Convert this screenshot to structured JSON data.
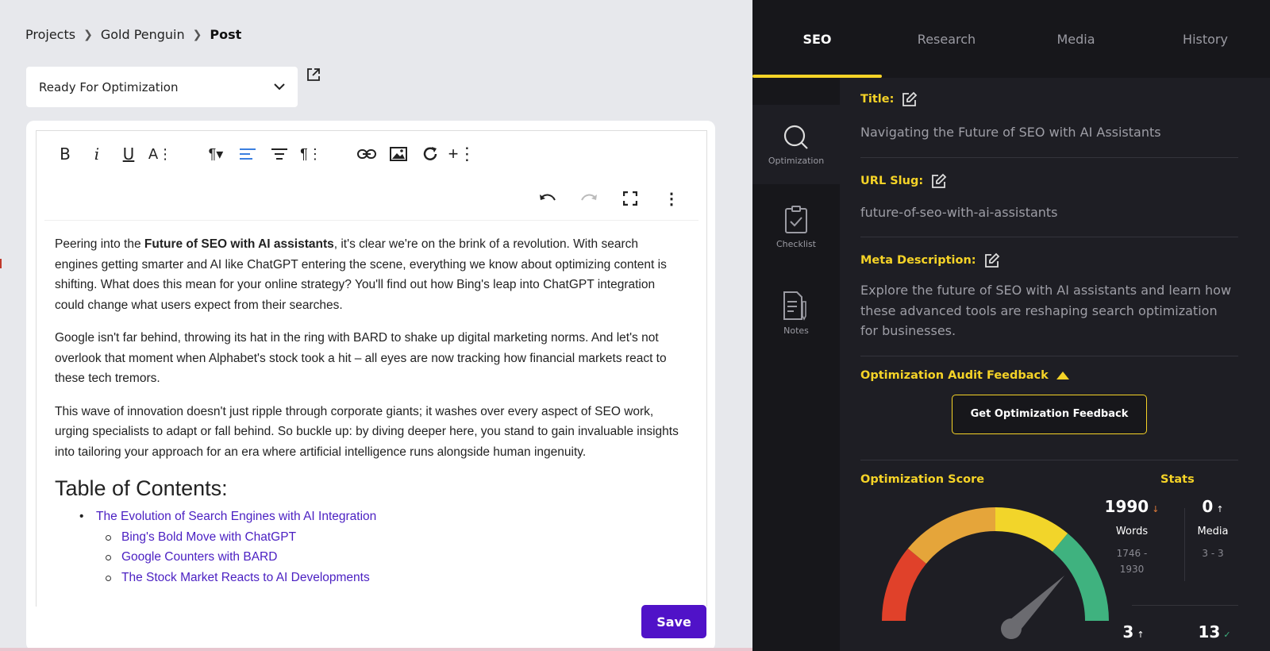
{
  "breadcrumb": {
    "items": [
      "Projects",
      "Gold Penguin"
    ],
    "current": "Post"
  },
  "status": {
    "selected": "Ready For Optimization"
  },
  "editor": {
    "paragraphs": {
      "p1_before": "Peering into the ",
      "p1_bold": "Future of SEO with AI assistants",
      "p1_after": ", it's clear we're on the brink of a revolution. With search engines getting smarter and AI like ChatGPT entering the scene, everything we know about optimizing content is shifting. What does this mean for your online strategy? You'll find out how Bing's leap into ChatGPT integration could change what users expect from their searches.",
      "p2": "Google isn't far behind, throwing its hat in the ring with BARD to shake up digital marketing norms. And let's not overlook that moment when Alphabet's stock took a hit – all eyes are now tracking how financial markets react to these tech tremors.",
      "p3": "This wave of innovation doesn't just ripple through corporate giants; it washes over every aspect of SEO work, urging specialists to adapt or fall behind. So buckle up: by diving deeper here, you stand to gain invaluable insights into tailoring your approach for an era where artificial intelligence runs alongside human ingenuity."
    },
    "toc_heading": "Table of Contents:",
    "toc": {
      "main": "The Evolution of Search Engines with AI Integration",
      "sub": [
        "Bing's Bold Move with ChatGPT",
        "Google Counters with BARD",
        "The Stock Market Reacts to AI Developments"
      ]
    },
    "save_label": "Save"
  },
  "tabs": [
    "SEO",
    "Research",
    "Media",
    "History"
  ],
  "side_nav": [
    "Optimization",
    "Checklist",
    "Notes"
  ],
  "seo": {
    "title_label": "Title:",
    "title_value": "Navigating the Future of SEO with AI Assistants",
    "slug_label": "URL Slug:",
    "slug_value": "future-of-seo-with-ai-assistants",
    "meta_label": "Meta Description:",
    "meta_value": "Explore the future of SEO with AI assistants and learn how these advanced tools are reshaping search optimization for businesses.",
    "audit_label": "Optimization Audit Feedback",
    "feedback_button": "Get Optimization Feedback",
    "score_label": "Optimization Score",
    "stats_label": "Stats"
  },
  "stats": {
    "words": {
      "value": "1990",
      "label": "Words",
      "range_from": "1746 -",
      "range_to": "1930"
    },
    "media": {
      "value": "0",
      "label": "Media",
      "range": "3 - 3"
    },
    "stat3": {
      "value": "3"
    },
    "stat4": {
      "value": "13"
    }
  },
  "gauge": {
    "needle_fraction": 0.75
  },
  "colors": {
    "accent": "#f5d327",
    "save": "#5012c8",
    "link": "#4a1fc2",
    "gauge_red": "#e0412a",
    "gauge_orange": "#e5a53a",
    "gauge_yellow": "#f2d52a",
    "gauge_green": "#3fb27f"
  }
}
